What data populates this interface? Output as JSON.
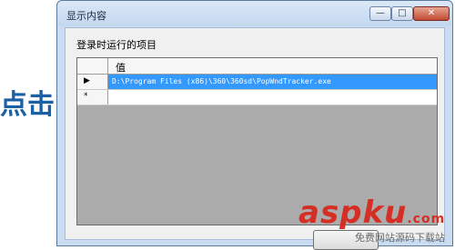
{
  "dialog": {
    "title": "显示内容",
    "controls": {
      "minimize": "—",
      "maximize": "□",
      "close": "✕"
    },
    "label": "登录时运行的项目",
    "grid": {
      "column_header": "值",
      "rows": [
        {
          "marker": "▶",
          "value": "D:\\Program Files (x86)\\360\\360sd\\PopWndTracker.exe"
        },
        {
          "marker": "*",
          "value": ""
        }
      ]
    }
  },
  "annotation": {
    "text": "点击"
  },
  "watermark": {
    "brand": "aspku",
    "tld": ".com",
    "tagline": "免费网站源码下载站"
  }
}
